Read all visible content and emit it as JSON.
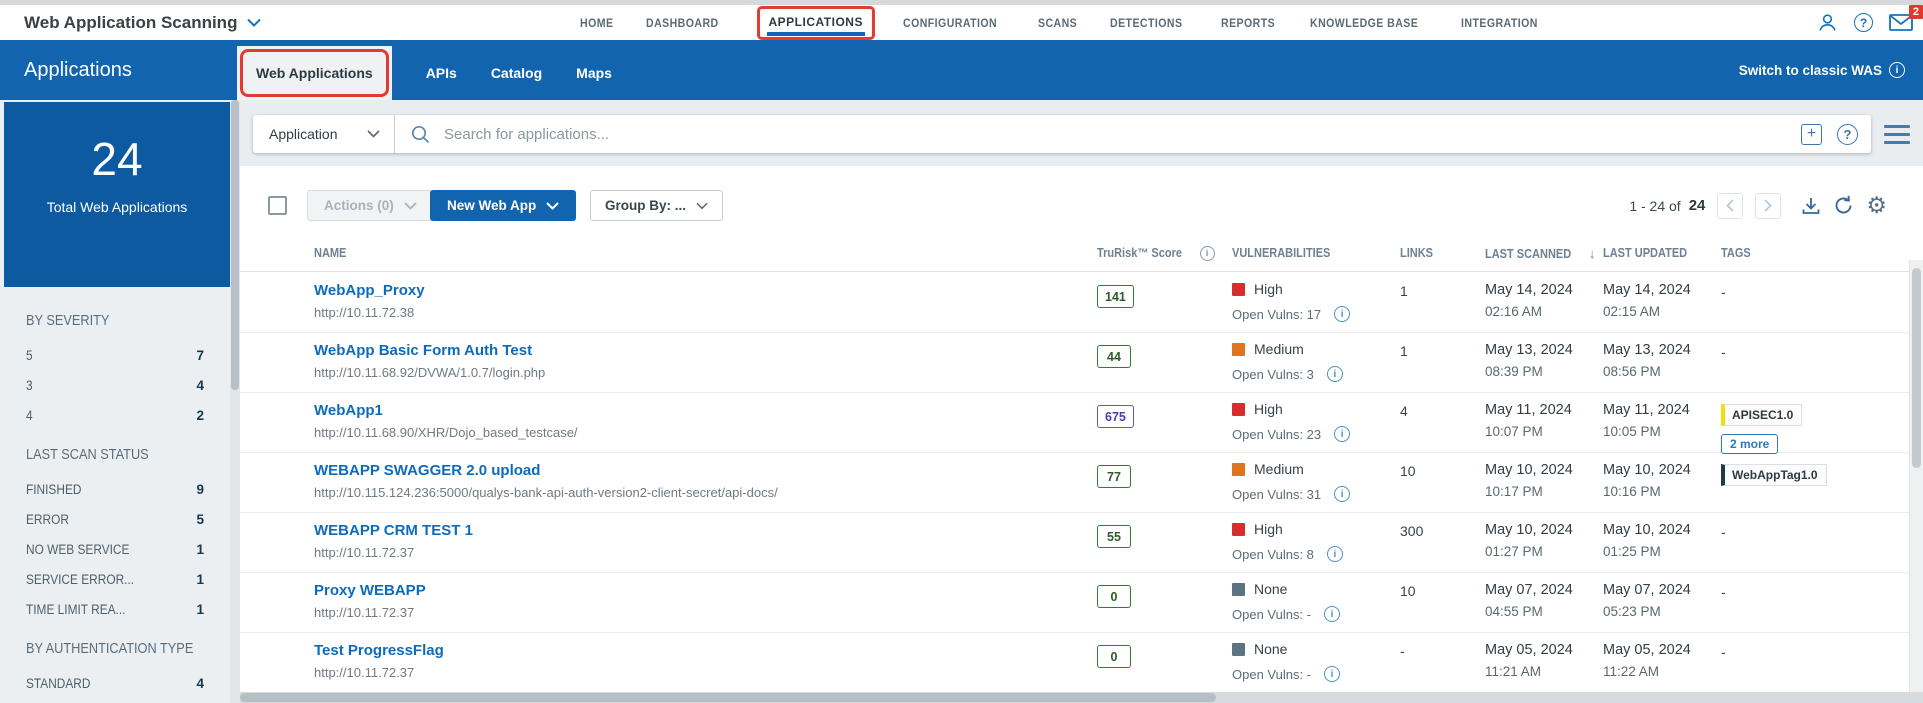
{
  "app": {
    "product_title": "Web Application Scanning",
    "nav": [
      "HOME",
      "DASHBOARD",
      "APPLICATIONS",
      "CONFIGURATION",
      "SCANS",
      "DETECTIONS",
      "REPORTS",
      "KNOWLEDGE BASE",
      "INTEGRATION"
    ],
    "active_nav": "APPLICATIONS",
    "notification_count": "2"
  },
  "header": {
    "title": "Applications",
    "tabs": [
      "Web Applications",
      "APIs",
      "Catalog",
      "Maps"
    ],
    "active_tab": "Web Applications",
    "switch_link": "Switch to classic WAS"
  },
  "sidebar": {
    "total_count": "24",
    "total_label": "Total Web Applications",
    "sections": [
      {
        "title": "BY SEVERITY",
        "rows": [
          {
            "label": "5",
            "value": "7"
          },
          {
            "label": "3",
            "value": "4"
          },
          {
            "label": "4",
            "value": "2"
          }
        ]
      },
      {
        "title": "LAST SCAN STATUS",
        "rows": [
          {
            "label": "FINISHED",
            "value": "9"
          },
          {
            "label": "ERROR",
            "value": "5"
          },
          {
            "label": "NO WEB SERVICE",
            "value": "1"
          },
          {
            "label": "SERVICE ERROR...",
            "value": "1"
          },
          {
            "label": "TIME LIMIT REA...",
            "value": "1"
          }
        ]
      },
      {
        "title": "BY AUTHENTICATION TYPE",
        "rows": [
          {
            "label": "STANDARD",
            "value": "4"
          }
        ]
      }
    ]
  },
  "search": {
    "scope": "Application",
    "placeholder": "Search for applications..."
  },
  "toolbar": {
    "actions_label": "Actions (0)",
    "new_button": "New Web App",
    "group_by": "Group By: ...",
    "pagination_range": "1 - 24 of",
    "pagination_total": "24"
  },
  "table": {
    "columns": [
      {
        "label": "NAME"
      },
      {
        "label": "TruRisk™ Score",
        "icon": "info"
      },
      {
        "label": "VULNERABILITIES"
      },
      {
        "label": "LINKS"
      },
      {
        "label": "LAST SCANNED",
        "icon": "sort-down"
      },
      {
        "label": "LAST UPDATED"
      },
      {
        "label": "TAGS"
      }
    ],
    "rows": [
      {
        "name": "WebApp_Proxy",
        "url": "http://10.11.72.38",
        "score": "141",
        "score_color": "green",
        "severity": "High",
        "severity_level": "high",
        "open_vulns": "Open Vulns: 17",
        "links": "1",
        "scanned_date": "May 14, 2024",
        "scanned_time": "02:16 AM",
        "updated_date": "May 14, 2024",
        "updated_time": "02:15 AM",
        "tags": [],
        "tags_placeholder": "-"
      },
      {
        "name": "WebApp Basic Form Auth Test",
        "url": "http://10.11.68.92/DVWA/1.0.7/login.php",
        "score": "44",
        "score_color": "green",
        "severity": "Medium",
        "severity_level": "medium",
        "open_vulns": "Open Vulns: 3",
        "links": "1",
        "scanned_date": "May 13, 2024",
        "scanned_time": "08:39 PM",
        "updated_date": "May 13, 2024",
        "updated_time": "08:56 PM",
        "tags": [],
        "tags_placeholder": "-"
      },
      {
        "name": "WebApp1",
        "url": "http://10.11.68.90/XHR/Dojo_based_testcase/",
        "score": "675",
        "score_color": "purple",
        "severity": "High",
        "severity_level": "high",
        "open_vulns": "Open Vulns: 23",
        "links": "4",
        "scanned_date": "May 11, 2024",
        "scanned_time": "10:07 PM",
        "updated_date": "May 11, 2024",
        "updated_time": "10:05 PM",
        "tags": [
          {
            "label": "APISEC1.0",
            "type": "yellow"
          }
        ],
        "more_label": "2 more"
      },
      {
        "name": "WEBAPP SWAGGER 2.0 upload",
        "url": "http://10.115.124.236:5000/qualys-bank-api-auth-version2-client-secret/api-docs/",
        "score": "77",
        "score_color": "green",
        "severity": "Medium",
        "severity_level": "medium",
        "open_vulns": "Open Vulns: 31",
        "links": "10",
        "scanned_date": "May 10, 2024",
        "scanned_time": "10:17 PM",
        "updated_date": "May 10, 2024",
        "updated_time": "10:16 PM",
        "tags": [
          {
            "label": "WebAppTag1.0",
            "type": "dark"
          }
        ]
      },
      {
        "name": "WEBAPP CRM TEST 1",
        "url": "http://10.11.72.37",
        "score": "55",
        "score_color": "green",
        "severity": "High",
        "severity_level": "high",
        "open_vulns": "Open Vulns: 8",
        "links": "300",
        "scanned_date": "May 10, 2024",
        "scanned_time": "01:27 PM",
        "updated_date": "May 10, 2024",
        "updated_time": "01:25 PM",
        "tags": [],
        "tags_placeholder": "-"
      },
      {
        "name": "Proxy WEBAPP",
        "url": "http://10.11.72.37",
        "score": "0",
        "score_color": "green",
        "severity": "None",
        "severity_level": "none",
        "open_vulns": "Open Vulns: -",
        "links": "10",
        "scanned_date": "May 07, 2024",
        "scanned_time": "04:55 PM",
        "updated_date": "May 07, 2024",
        "updated_time": "05:23 PM",
        "tags": [],
        "tags_placeholder": "-"
      },
      {
        "name": "Test ProgressFlag",
        "url": "http://10.11.72.37",
        "score": "0",
        "score_color": "green",
        "severity": "None",
        "severity_level": "none",
        "open_vulns": "Open Vulns: -",
        "links": "-",
        "scanned_date": "May 05, 2024",
        "scanned_time": "11:21 AM",
        "updated_date": "May 05, 2024",
        "updated_time": "11:22 AM",
        "tags": [],
        "tags_placeholder": "-"
      }
    ]
  },
  "colors": {
    "brand_blue": "#1164ad",
    "sidebar_blue": "#0e5aa1",
    "link_blue": "#0d6bbd",
    "severity_high": "#d92b2b",
    "severity_medium": "#e0731e",
    "severity_none": "#5c7482",
    "score_green": "#2e7d32",
    "score_purple": "#6055c8",
    "annotation_red": "#e23c32",
    "tag_yellow": "#f2e005",
    "tag_dark": "#1f3a47",
    "badge_red": "#e03a2f"
  }
}
